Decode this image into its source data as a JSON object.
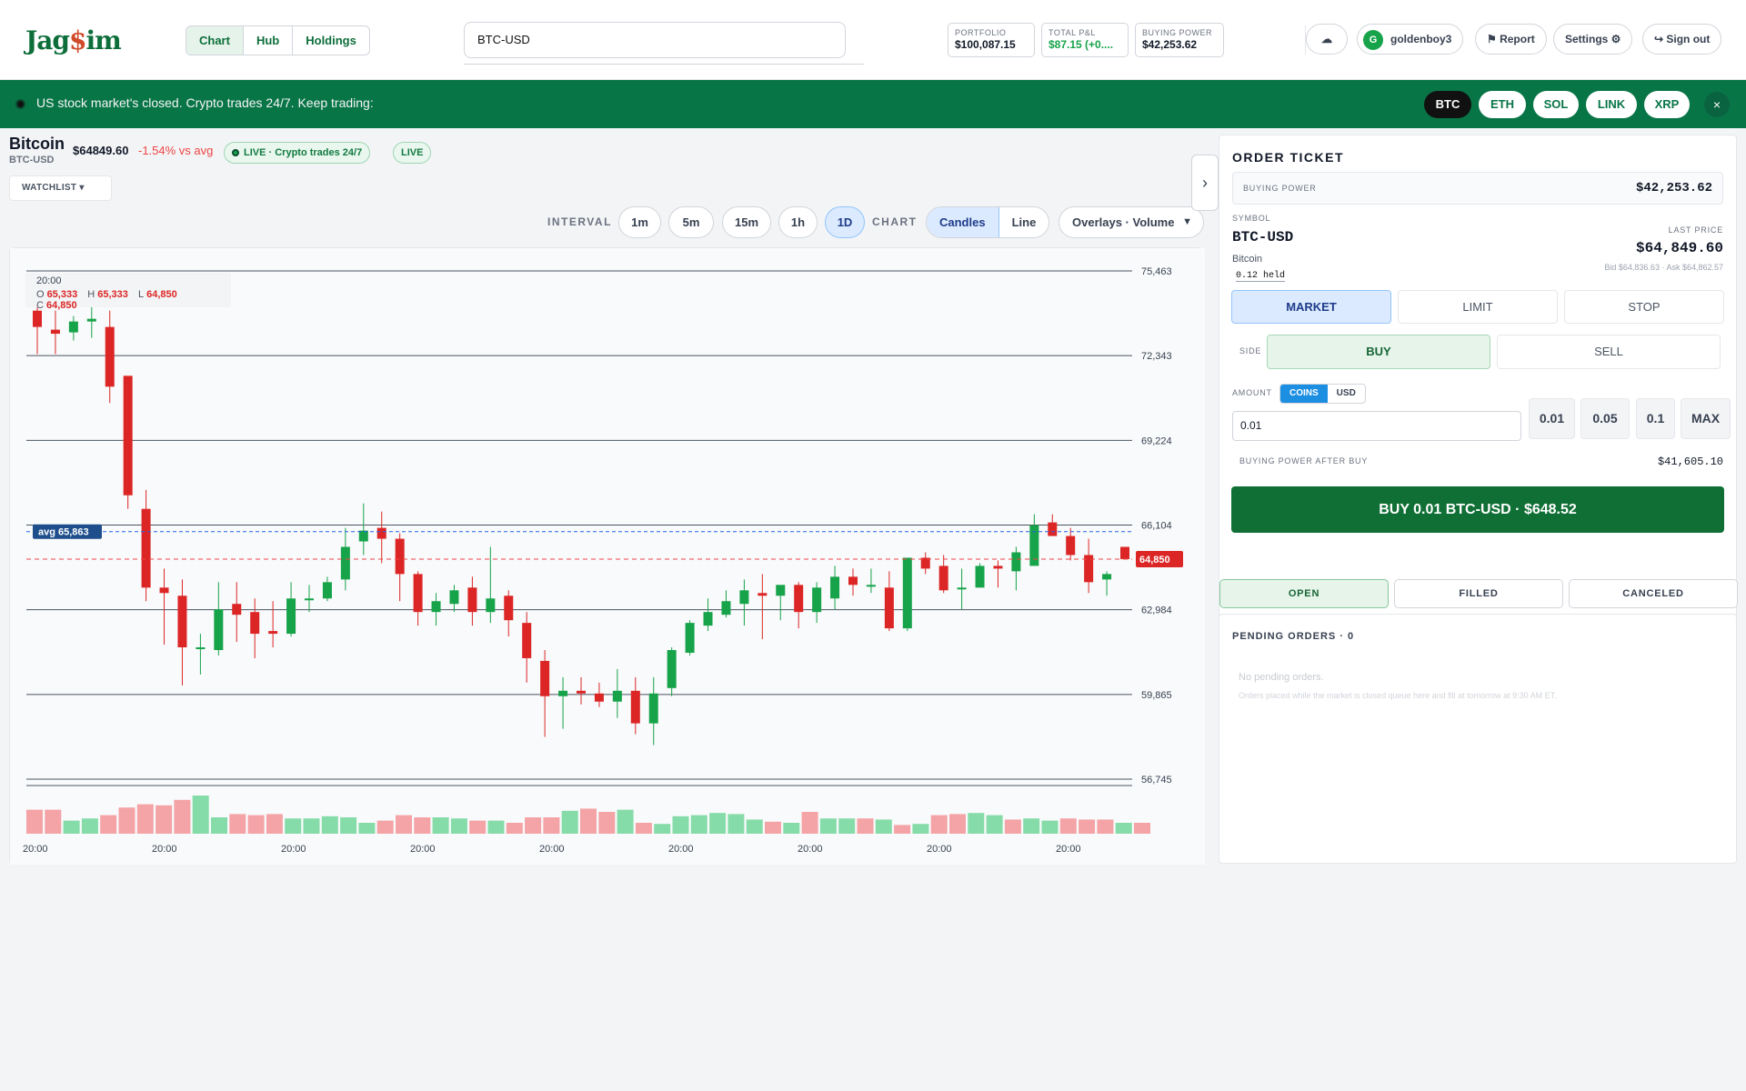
{
  "header": {
    "logo": "JagSim",
    "nav_tabs": [
      "Chart",
      "Hub",
      "Holdings"
    ],
    "search_value": "BTC-USD",
    "stats": [
      {
        "label": "PORTFOLIO",
        "value": "$100,087.15"
      },
      {
        "label": "TOTAL P&L",
        "value": "$87.15 (+0...."
      },
      {
        "label": "BUYING POWER",
        "value": "$42,253.62"
      }
    ],
    "username": "goldenboy3",
    "avatar_initial": "G",
    "report_label": "⚑ Report",
    "settings_label": "Settings ⚙",
    "signout_label": "↪ Sign out",
    "theme_icon": "☁"
  },
  "banner": {
    "text": "US stock market's closed. Crypto trades 24/7. Keep trading:",
    "coins": [
      "BTC",
      "ETH",
      "SOL",
      "LINK",
      "XRP"
    ],
    "close": "×"
  },
  "asset": {
    "name": "Bitcoin",
    "symbol": "BTC-USD",
    "price": "$64849.60",
    "change": "-1.54% vs avg",
    "live_badge": "LIVE · Crypto trades 24/7",
    "live_tag": "LIVE",
    "watchlist": "WATCHLIST ▾"
  },
  "controls": {
    "interval_label": "INTERVAL",
    "intervals": [
      "1m",
      "5m",
      "15m",
      "1h",
      "1D"
    ],
    "chart_label": "CHART",
    "chart_types": [
      "Candles",
      "Line"
    ],
    "overlays": "Overlays · Volume",
    "collapse": "›"
  },
  "ohlc": {
    "time": "20:00",
    "o": "65,333",
    "h": "65,333",
    "l": "64,850",
    "c": "64,850"
  },
  "chart_data": {
    "type": "candlestick",
    "price_ticks": [
      75463,
      72343,
      69224,
      66104,
      62984,
      59865,
      56745
    ],
    "x_tick_labels": [
      "20:00",
      "20:00",
      "20:00",
      "20:00",
      "20:00",
      "20:00",
      "20:00",
      "20:00",
      "20:00"
    ],
    "avg_line": {
      "label": "avg 65,863",
      "value": 65863
    },
    "last_price": {
      "label": "64,850",
      "value": 64850
    },
    "ylim": [
      56745,
      75463
    ],
    "candles": [
      {
        "o": 74000,
        "h": 74700,
        "c": 73400,
        "l": 72400
      },
      {
        "o": 73300,
        "h": 74000,
        "c": 73150,
        "l": 72400
      },
      {
        "o": 73200,
        "h": 73800,
        "c": 73600,
        "l": 72900
      },
      {
        "o": 73600,
        "h": 74600,
        "c": 73700,
        "l": 73000
      },
      {
        "o": 73400,
        "h": 74000,
        "c": 71200,
        "l": 70600
      },
      {
        "o": 71600,
        "h": 71600,
        "c": 67200,
        "l": 66700
      },
      {
        "o": 66700,
        "h": 67400,
        "c": 63800,
        "l": 63300
      },
      {
        "o": 63800,
        "h": 64500,
        "c": 63600,
        "l": 61700
      },
      {
        "o": 63500,
        "h": 64100,
        "c": 61600,
        "l": 60200
      },
      {
        "o": 61600,
        "h": 62100,
        "c": 61600,
        "l": 60600
      },
      {
        "o": 61500,
        "h": 64000,
        "c": 63000,
        "l": 61300
      },
      {
        "o": 63200,
        "h": 64000,
        "c": 62800,
        "l": 61800
      },
      {
        "o": 62900,
        "h": 63400,
        "c": 62100,
        "l": 61200
      },
      {
        "o": 62200,
        "h": 63300,
        "c": 62100,
        "l": 61600
      },
      {
        "o": 62100,
        "h": 64000,
        "c": 63400,
        "l": 62000
      },
      {
        "o": 63400,
        "h": 63900,
        "c": 63400,
        "l": 62900
      },
      {
        "o": 63400,
        "h": 64200,
        "c": 64000,
        "l": 63300
      },
      {
        "o": 64100,
        "h": 66000,
        "c": 65300,
        "l": 63700
      },
      {
        "o": 65500,
        "h": 66900,
        "c": 65900,
        "l": 65000
      },
      {
        "o": 66000,
        "h": 66600,
        "c": 65600,
        "l": 64700
      },
      {
        "o": 65600,
        "h": 65800,
        "c": 64300,
        "l": 63300
      },
      {
        "o": 64300,
        "h": 64400,
        "c": 62900,
        "l": 62400
      },
      {
        "o": 62900,
        "h": 63600,
        "c": 63300,
        "l": 62400
      },
      {
        "o": 63200,
        "h": 63900,
        "c": 63700,
        "l": 62900
      },
      {
        "o": 63800,
        "h": 64200,
        "c": 62900,
        "l": 62400
      },
      {
        "o": 62900,
        "h": 65300,
        "c": 63400,
        "l": 62500
      },
      {
        "o": 63500,
        "h": 63700,
        "c": 62600,
        "l": 62000
      },
      {
        "o": 62500,
        "h": 62900,
        "c": 61200,
        "l": 60300
      },
      {
        "o": 61100,
        "h": 61500,
        "c": 59800,
        "l": 58300
      },
      {
        "o": 59800,
        "h": 60500,
        "c": 60000,
        "l": 58600
      },
      {
        "o": 60000,
        "h": 60500,
        "c": 59900,
        "l": 59500
      },
      {
        "o": 59900,
        "h": 60300,
        "c": 59600,
        "l": 59400
      },
      {
        "o": 59600,
        "h": 60800,
        "c": 60000,
        "l": 59000
      },
      {
        "o": 60000,
        "h": 60500,
        "c": 58800,
        "l": 58400
      },
      {
        "o": 58800,
        "h": 60500,
        "c": 59900,
        "l": 58000
      },
      {
        "o": 60100,
        "h": 61600,
        "c": 61500,
        "l": 59800
      },
      {
        "o": 61400,
        "h": 62600,
        "c": 62500,
        "l": 61300
      },
      {
        "o": 62400,
        "h": 63400,
        "c": 62900,
        "l": 62200
      },
      {
        "o": 62800,
        "h": 63700,
        "c": 63300,
        "l": 62700
      },
      {
        "o": 63200,
        "h": 64100,
        "c": 63700,
        "l": 62400
      },
      {
        "o": 63600,
        "h": 64300,
        "c": 63500,
        "l": 61900
      },
      {
        "o": 63500,
        "h": 63800,
        "c": 63900,
        "l": 62600
      },
      {
        "o": 63900,
        "h": 64000,
        "c": 62900,
        "l": 62300
      },
      {
        "o": 62900,
        "h": 64000,
        "c": 63800,
        "l": 62500
      },
      {
        "o": 63400,
        "h": 64600,
        "c": 64200,
        "l": 63000
      },
      {
        "o": 64200,
        "h": 64500,
        "c": 63900,
        "l": 63500
      },
      {
        "o": 63900,
        "h": 64500,
        "c": 63900,
        "l": 63600
      },
      {
        "o": 63800,
        "h": 64400,
        "c": 62300,
        "l": 62200
      },
      {
        "o": 62300,
        "h": 64900,
        "c": 64900,
        "l": 62200
      },
      {
        "o": 64900,
        "h": 65100,
        "c": 64500,
        "l": 64300
      },
      {
        "o": 64600,
        "h": 65000,
        "c": 63700,
        "l": 63600
      },
      {
        "o": 63800,
        "h": 64500,
        "c": 63800,
        "l": 63000
      },
      {
        "o": 63800,
        "h": 64700,
        "c": 64600,
        "l": 63800
      },
      {
        "o": 64600,
        "h": 64800,
        "c": 64500,
        "l": 63800
      },
      {
        "o": 64400,
        "h": 65300,
        "c": 65100,
        "l": 63700
      },
      {
        "o": 64600,
        "h": 66500,
        "c": 66100,
        "l": 64600
      },
      {
        "o": 66200,
        "h": 66500,
        "c": 65700,
        "l": 65700
      },
      {
        "o": 65700,
        "h": 66000,
        "c": 65000,
        "l": 64800
      },
      {
        "o": 65000,
        "h": 65600,
        "c": 64000,
        "l": 63600
      },
      {
        "o": 64100,
        "h": 64400,
        "c": 64300,
        "l": 63500
      },
      {
        "o": 65300,
        "h": 65300,
        "c": 64850,
        "l": 64850
      }
    ],
    "volume": [
      22,
      22,
      12,
      14,
      17,
      24,
      27,
      26,
      31,
      35,
      15,
      18,
      17,
      18,
      14,
      14,
      16,
      15,
      10,
      12,
      17,
      15,
      15,
      14,
      12,
      12,
      10,
      15,
      15,
      21,
      23,
      20,
      22,
      10,
      9,
      16,
      17,
      19,
      18,
      13,
      11,
      10,
      20,
      14,
      14,
      14,
      13,
      8,
      9,
      17,
      18,
      19,
      17,
      13,
      14,
      12,
      14,
      13,
      13,
      10,
      10
    ]
  },
  "ticket": {
    "title": "ORDER TICKET",
    "buying_power_label": "BUYING POWER",
    "buying_power_value": "$42,253.62",
    "symbol_label": "SYMBOL",
    "symbol": "BTC-USD",
    "symbol_name": "Bitcoin",
    "held": "0.12 held",
    "last_price_label": "LAST PRICE",
    "last_price": "$64,849.60",
    "bid_ask": "Bid $64,836.63 · Ask $64,862.57",
    "order_types": [
      "MARKET",
      "LIMIT",
      "STOP"
    ],
    "side_label": "SIDE",
    "sides": [
      "BUY",
      "SELL"
    ],
    "amount_label": "AMOUNT",
    "units": [
      "COINS",
      "USD"
    ],
    "amount_value": "0.01",
    "quick_amounts": [
      "0.01",
      "0.05",
      "0.1",
      "MAX"
    ],
    "bp_after_label": "BUYING POWER AFTER BUY",
    "bp_after_value": "$41,605.10",
    "submit": "BUY 0.01 BTC-USD · $648.52"
  },
  "orders": {
    "tabs": [
      "OPEN",
      "FILLED",
      "CANCELED"
    ],
    "pending_title": "PENDING ORDERS · 0",
    "empty": "No pending orders.",
    "empty_sub": "Orders placed while the market is closed queue here and fill at tomorrow at 9:30 AM ET."
  },
  "colors": {
    "brand_green": "#087547",
    "up": "#16a34a",
    "down": "#dc2626",
    "accent_blue": "#1d8fe3"
  }
}
